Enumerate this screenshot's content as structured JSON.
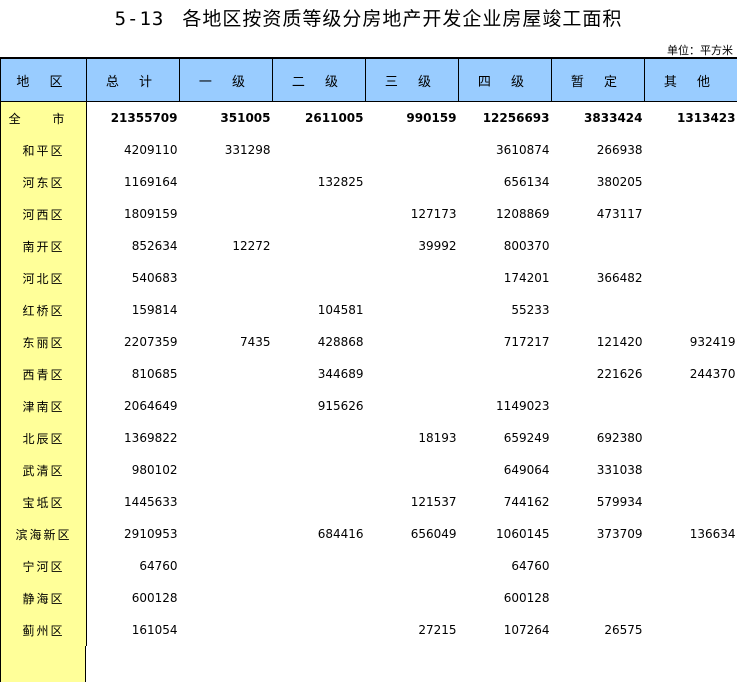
{
  "title": {
    "number": "5-13",
    "text": "各地区按资质等级分房地产开发企业房屋竣工面积"
  },
  "unit": "单位：平方米",
  "headers": [
    "地 区",
    "总 计",
    "一 级",
    "二 级",
    "三 级",
    "四 级",
    "暂 定",
    "其 他"
  ],
  "rows": [
    {
      "region": "全 市",
      "cells": [
        "21355709",
        "351005",
        "2611005",
        "990159",
        "12256693",
        "3833424",
        "1313423"
      ]
    },
    {
      "region": "和平区",
      "cells": [
        "4209110",
        "331298",
        "",
        "",
        "3610874",
        "266938",
        ""
      ]
    },
    {
      "region": "河东区",
      "cells": [
        "1169164",
        "",
        "132825",
        "",
        "656134",
        "380205",
        ""
      ]
    },
    {
      "region": "河西区",
      "cells": [
        "1809159",
        "",
        "",
        "127173",
        "1208869",
        "473117",
        ""
      ]
    },
    {
      "region": "南开区",
      "cells": [
        "852634",
        "12272",
        "",
        "39992",
        "800370",
        "",
        ""
      ]
    },
    {
      "region": "河北区",
      "cells": [
        "540683",
        "",
        "",
        "",
        "174201",
        "366482",
        ""
      ]
    },
    {
      "region": "红桥区",
      "cells": [
        "159814",
        "",
        "104581",
        "",
        "55233",
        "",
        ""
      ]
    },
    {
      "region": "东丽区",
      "cells": [
        "2207359",
        "7435",
        "428868",
        "",
        "717217",
        "121420",
        "932419"
      ]
    },
    {
      "region": "西青区",
      "cells": [
        "810685",
        "",
        "344689",
        "",
        "",
        "221626",
        "244370"
      ]
    },
    {
      "region": "津南区",
      "cells": [
        "2064649",
        "",
        "915626",
        "",
        "1149023",
        "",
        ""
      ]
    },
    {
      "region": "北辰区",
      "cells": [
        "1369822",
        "",
        "",
        "18193",
        "659249",
        "692380",
        ""
      ]
    },
    {
      "region": "武清区",
      "cells": [
        "980102",
        "",
        "",
        "",
        "649064",
        "331038",
        ""
      ]
    },
    {
      "region": "宝坻区",
      "cells": [
        "1445633",
        "",
        "",
        "121537",
        "744162",
        "579934",
        ""
      ]
    },
    {
      "region": "滨海新区",
      "cells": [
        "2910953",
        "",
        "684416",
        "656049",
        "1060145",
        "373709",
        "136634"
      ]
    },
    {
      "region": "宁河区",
      "cells": [
        "64760",
        "",
        "",
        "",
        "64760",
        "",
        ""
      ]
    },
    {
      "region": "静海区",
      "cells": [
        "600128",
        "",
        "",
        "",
        "600128",
        "",
        ""
      ]
    },
    {
      "region": "蓟州区",
      "cells": [
        "161054",
        "",
        "",
        "27215",
        "107264",
        "26575",
        ""
      ]
    }
  ]
}
